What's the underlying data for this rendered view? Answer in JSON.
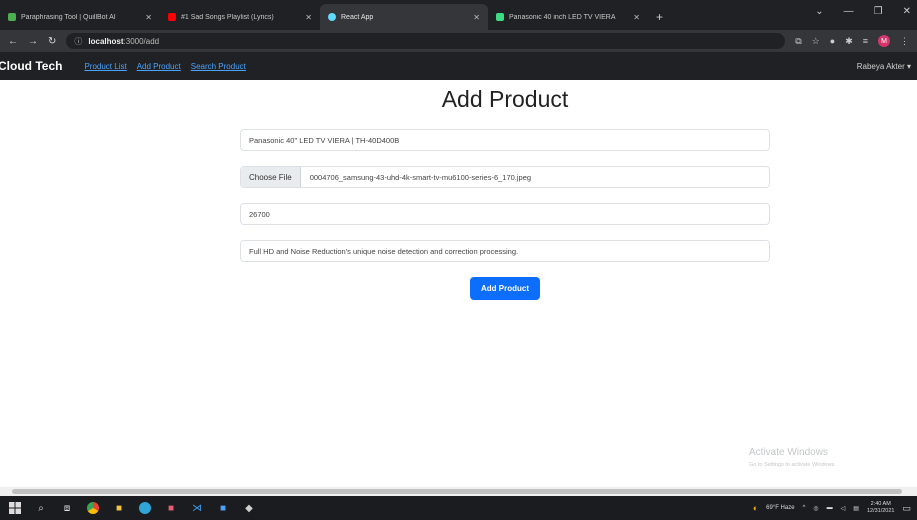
{
  "browser": {
    "tabs": [
      {
        "title": "Paraphrasing Tool | QuillBot AI",
        "favicon_color": "#4caf50",
        "active": false
      },
      {
        "title": "#1 Sad Songs Playlist (Lyrics)",
        "favicon_color": "#ff0000",
        "active": false
      },
      {
        "title": "React App",
        "favicon_color": "#61dafb",
        "active": true
      },
      {
        "title": "Panasonic 40 inch LED TV VIERA",
        "favicon_color": "#3ddc84",
        "active": false
      }
    ],
    "url_host": "localhost",
    "url_path": ":3000/add",
    "profile_initial": "M"
  },
  "navbar": {
    "brand": "Cloud Tech",
    "links": [
      "Product List",
      "Add Product",
      "Search Product"
    ],
    "user": "Rabeya Akter ▾"
  },
  "form": {
    "title": "Add Product",
    "name_value": "Panasonic 40\" LED TV VIERA | TH-40D400B",
    "file_button": "Choose File",
    "file_name": "0004706_samsung-43-uhd-4k-smart-tv-mu6100-series-6_170.jpeg",
    "price_value": "26700",
    "description_value": "Full HD and Noise Reduction's unique noise detection and correction processing.",
    "submit_label": "Add Product"
  },
  "watermark": {
    "line1": "Activate Windows",
    "line2": "Go to Settings to activate Windows."
  },
  "taskbar": {
    "weather": "69°F Haze",
    "time": "2:40 AM",
    "date": "12/31/2021"
  }
}
